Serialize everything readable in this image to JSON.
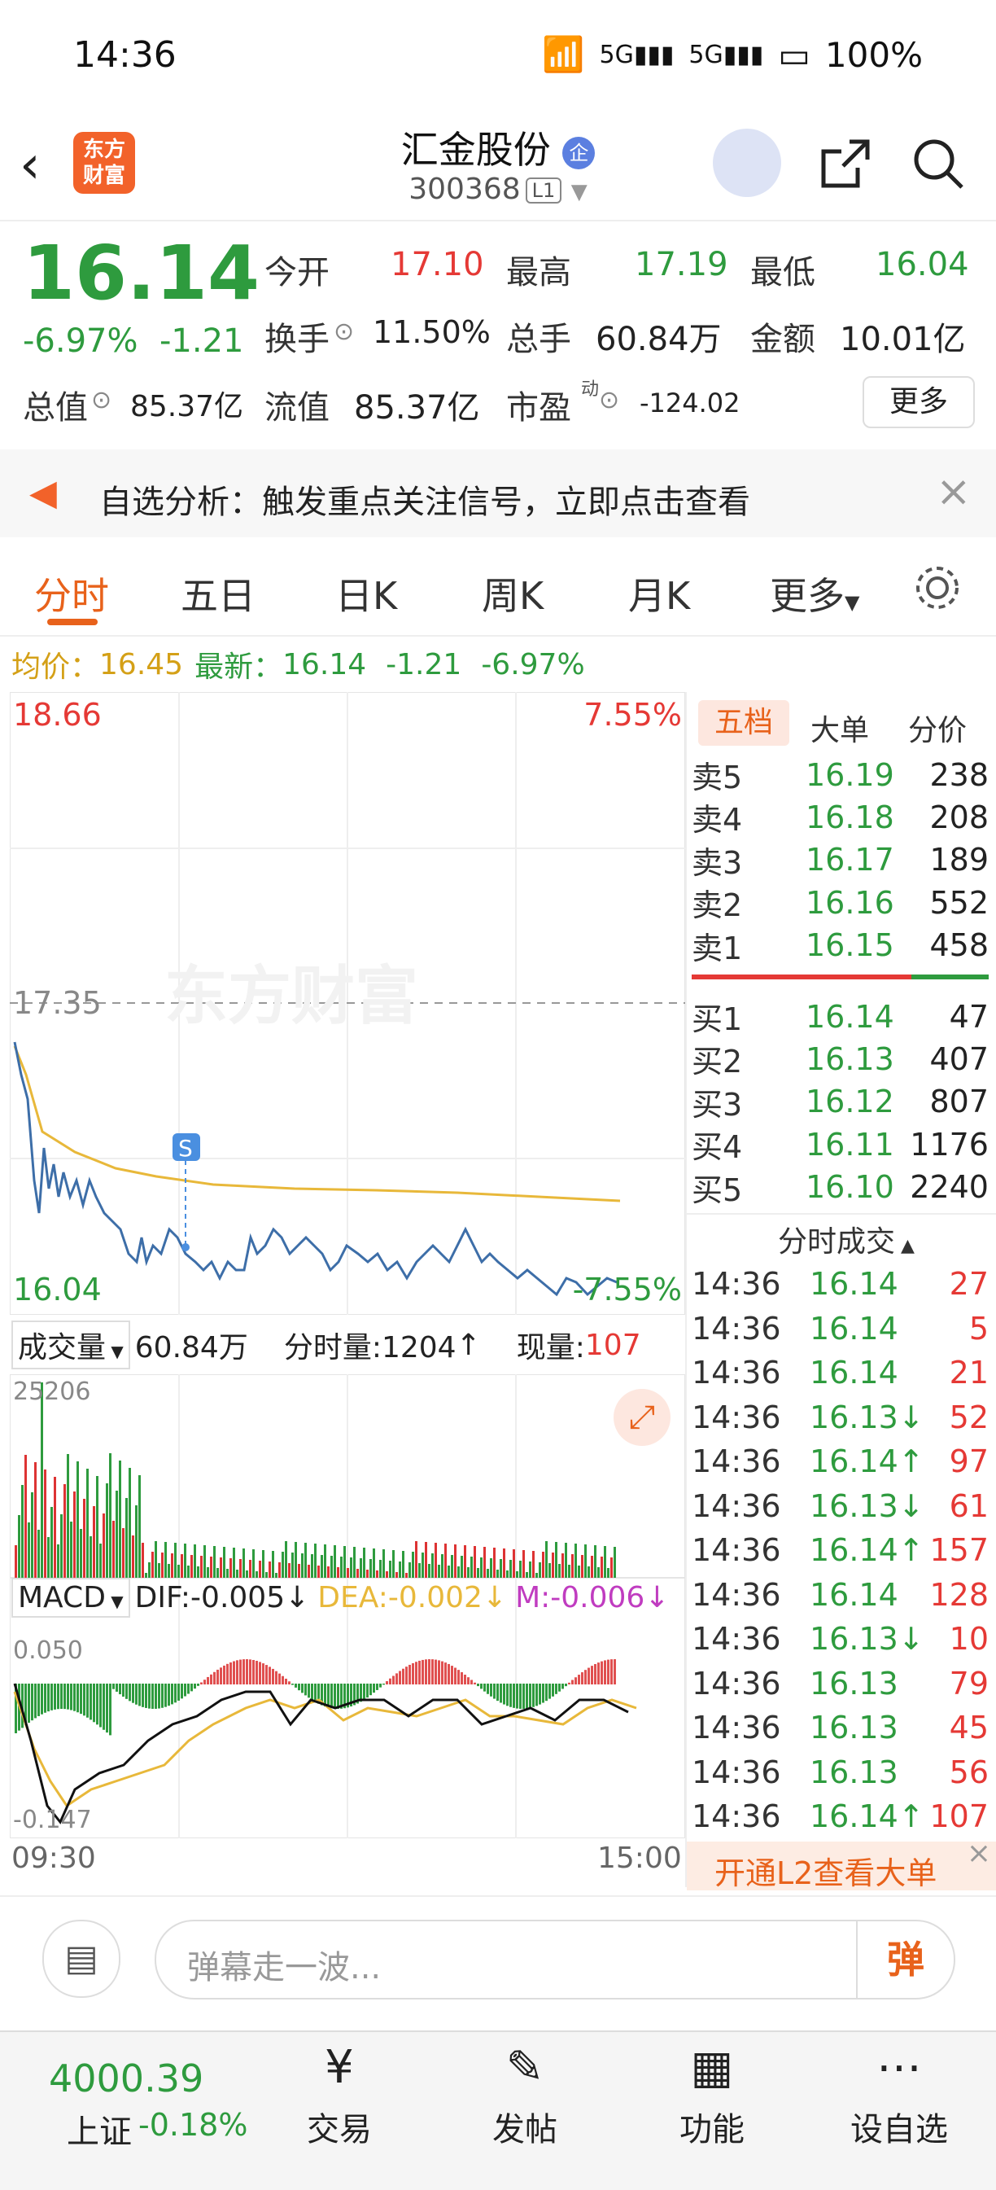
{
  "status": {
    "time": "14:36",
    "battery": "100%"
  },
  "header": {
    "logo_text": "东方财富",
    "stock_name": "汇金股份",
    "stock_code": "300368",
    "level_badge": "L1"
  },
  "quote": {
    "price": "16.14",
    "change_pct": "-6.97%",
    "change_amt": "-1.21",
    "open_label": "今开",
    "open": "17.10",
    "high_label": "最高",
    "high": "17.19",
    "low_label": "最低",
    "low": "16.04",
    "turnover_label": "换手",
    "turnover": "11.50%",
    "volume_label": "总手",
    "volume": "60.84万",
    "amount_label": "金额",
    "amount": "10.01亿",
    "total_value_label": "总值",
    "total_value": "85.37亿",
    "float_value_label": "流值",
    "float_value": "85.37亿",
    "pe_label": "市盈",
    "pe_sup": "动",
    "pe": "-124.02",
    "more": "更多"
  },
  "notice": {
    "text": "自选分析：触发重点关注信号，立即点击查看"
  },
  "tabs": [
    "分时",
    "五日",
    "日K",
    "周K",
    "月K",
    "更多"
  ],
  "summary": {
    "avg_label": "均价：",
    "avg": "16.45",
    "latest_label": "最新：",
    "latest": "16.14",
    "chg": "-1.21",
    "pct": "-6.97%"
  },
  "chart_labels": {
    "top_price": "18.66",
    "top_pct": "7.55%",
    "mid_price": "17.35",
    "bottom_price": "16.04",
    "bottom_pct": "-7.55%",
    "marker": "S",
    "watermark": "东方财富"
  },
  "vol_bar": {
    "label": "成交量",
    "total": "60.84万",
    "minute_vol": "分时量:1204",
    "cur_label": "现量:",
    "cur": "107",
    "max": "25206"
  },
  "macd": {
    "label": "MACD",
    "dif": "DIF:-0.005",
    "dea": "DEA:-0.002",
    "m": "M:-0.006",
    "top": "0.050",
    "bottom": "-0.147"
  },
  "time_axis": {
    "start": "09:30",
    "end": "15:00"
  },
  "book_tabs": [
    "五档",
    "大单",
    "分价"
  ],
  "asks": [
    {
      "k": "卖5",
      "p": "16.19",
      "v": "238"
    },
    {
      "k": "卖4",
      "p": "16.18",
      "v": "208"
    },
    {
      "k": "卖3",
      "p": "16.17",
      "v": "189"
    },
    {
      "k": "卖2",
      "p": "16.16",
      "v": "552"
    },
    {
      "k": "卖1",
      "p": "16.15",
      "v": "458"
    }
  ],
  "bids": [
    {
      "k": "买1",
      "p": "16.14",
      "v": "47"
    },
    {
      "k": "买2",
      "p": "16.13",
      "v": "407"
    },
    {
      "k": "买3",
      "p": "16.12",
      "v": "807"
    },
    {
      "k": "买4",
      "p": "16.11",
      "v": "1176"
    },
    {
      "k": "买5",
      "p": "16.10",
      "v": "2240"
    }
  ],
  "trades_title": "分时成交",
  "trades": [
    {
      "t": "14:36",
      "p": "16.14",
      "v": "27"
    },
    {
      "t": "14:36",
      "p": "16.14",
      "v": "5"
    },
    {
      "t": "14:36",
      "p": "16.14",
      "v": "21"
    },
    {
      "t": "14:36",
      "p": "16.13↓",
      "v": "52"
    },
    {
      "t": "14:36",
      "p": "16.14↑",
      "v": "97"
    },
    {
      "t": "14:36",
      "p": "16.13↓",
      "v": "61"
    },
    {
      "t": "14:36",
      "p": "16.14↑",
      "v": "157"
    },
    {
      "t": "14:36",
      "p": "16.14",
      "v": "128"
    },
    {
      "t": "14:36",
      "p": "16.13↓",
      "v": "10"
    },
    {
      "t": "14:36",
      "p": "16.13",
      "v": "79"
    },
    {
      "t": "14:36",
      "p": "16.13",
      "v": "45"
    },
    {
      "t": "14:36",
      "p": "16.13",
      "v": "56"
    },
    {
      "t": "14:36",
      "p": "16.14↑",
      "v": "107"
    }
  ],
  "l2_banner": "开通L2查看大单",
  "comment": {
    "placeholder": "弹幕走一波...",
    "send": "弹"
  },
  "index": {
    "value": "4000.39",
    "name": "上证",
    "pct": "-0.18%"
  },
  "nav": [
    "交易",
    "发帖",
    "功能",
    "设自选"
  ]
}
